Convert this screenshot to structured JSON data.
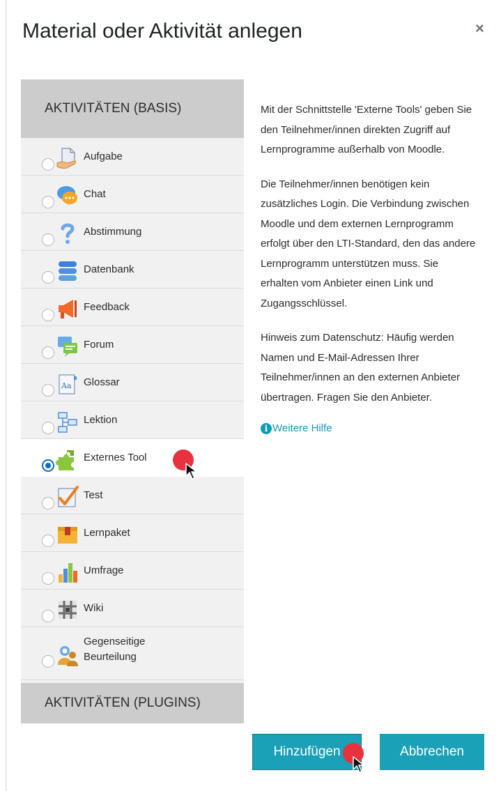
{
  "dialog": {
    "title": "Material oder Aktivität anlegen",
    "close_glyph": "×"
  },
  "categories": {
    "basis": "AKTIVITÄTEN (BASIS)",
    "plugins": "AKTIVITÄTEN (PLUGINS)"
  },
  "activities": [
    {
      "label": "Aufgabe",
      "icon": "assignment-icon",
      "selected": false
    },
    {
      "label": "Chat",
      "icon": "chat-icon",
      "selected": false
    },
    {
      "label": "Abstimmung",
      "icon": "choice-question-icon",
      "selected": false
    },
    {
      "label": "Datenbank",
      "icon": "database-icon",
      "selected": false
    },
    {
      "label": "Feedback",
      "icon": "megaphone-icon",
      "selected": false
    },
    {
      "label": "Forum",
      "icon": "forum-icon",
      "selected": false
    },
    {
      "label": "Glossar",
      "icon": "glossary-icon",
      "selected": false
    },
    {
      "label": "Lektion",
      "icon": "lesson-icon",
      "selected": false
    },
    {
      "label": "Externes Tool",
      "icon": "puzzle-icon",
      "selected": true
    },
    {
      "label": "Test",
      "icon": "quiz-check-icon",
      "selected": false
    },
    {
      "label": "Lernpaket",
      "icon": "package-icon",
      "selected": false
    },
    {
      "label": "Umfrage",
      "icon": "survey-chart-icon",
      "selected": false
    },
    {
      "label": "Wiki",
      "icon": "wiki-icon",
      "selected": false
    },
    {
      "label": "Gegenseitige Beurteilung",
      "icon": "workshop-people-icon",
      "selected": false
    }
  ],
  "help": {
    "paragraphs": [
      "Mit der Schnittstelle 'Externe Tools' geben Sie den Teilnehmer/innen direkten Zugriff auf Lernprogramme außerhalb von Moodle.",
      "Die Teilnehmer/innen benötigen kein zusätzliches Login. Die Verbindung zwischen Moodle und dem externen Lernprogramm erfolgt über den LTI-Standard, den das andere Lernprogramm unterstützen muss. Sie erhalten vom Anbieter einen Link und Zugangsschlüssel.",
      "Hinweis zum Datenschutz: Häufig werden Namen und E-Mail-Adressen Ihrer Teilnehmer/innen an den externen Anbieter übertragen. Fragen Sie den Anbieter."
    ],
    "link_label": "Weitere Hilfe",
    "link_icon": "info-icon",
    "info_glyph": "i"
  },
  "buttons": {
    "add": "Hinzufügen",
    "cancel": "Abbrechen"
  },
  "colors": {
    "accent": "#1aa0b7",
    "radio_selected": "#0f6cbf",
    "click_marker": "#e8323f"
  }
}
